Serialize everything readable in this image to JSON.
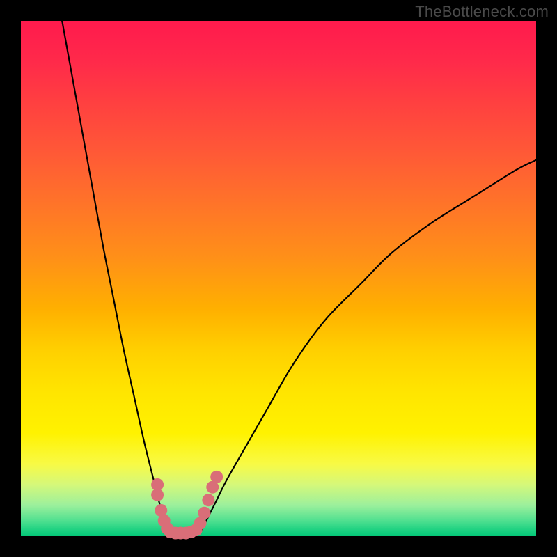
{
  "watermark": "TheBottleneck.com",
  "chart_data": {
    "type": "line",
    "title": "",
    "xlabel": "",
    "ylabel": "",
    "xlim": [
      0,
      100
    ],
    "ylim": [
      0,
      100
    ],
    "series": [
      {
        "name": "curve-left",
        "x": [
          8,
          10,
          12,
          14,
          16,
          18,
          20,
          22,
          24,
          26,
          27,
          28,
          28.5
        ],
        "values": [
          100,
          89,
          78,
          67,
          56,
          46,
          36,
          27,
          18,
          10,
          6,
          3,
          1
        ]
      },
      {
        "name": "curve-right",
        "x": [
          35,
          36,
          38,
          40,
          44,
          48,
          52,
          56,
          60,
          66,
          72,
          80,
          88,
          96,
          100
        ],
        "values": [
          1,
          3,
          7,
          11,
          18,
          25,
          32,
          38,
          43,
          49,
          55,
          61,
          66,
          71,
          73
        ]
      }
    ],
    "markers": [
      {
        "name": "dots-left",
        "x": [
          26.5,
          26.5,
          27.2,
          27.8,
          28.4
        ],
        "values": [
          10,
          8,
          5,
          3,
          1.5
        ],
        "color": "#d96e78"
      },
      {
        "name": "dots-right",
        "x": [
          34.0,
          34.8,
          35.6,
          36.4,
          37.2,
          38.0
        ],
        "values": [
          1.2,
          2.5,
          4.5,
          7,
          9.5,
          11.5
        ],
        "color": "#d96e78"
      },
      {
        "name": "dots-bottom",
        "x": [
          29.0,
          30.0,
          31.0,
          32.0,
          33.0
        ],
        "values": [
          0.8,
          0.6,
          0.6,
          0.6,
          0.8
        ],
        "color": "#d96e78"
      }
    ]
  }
}
